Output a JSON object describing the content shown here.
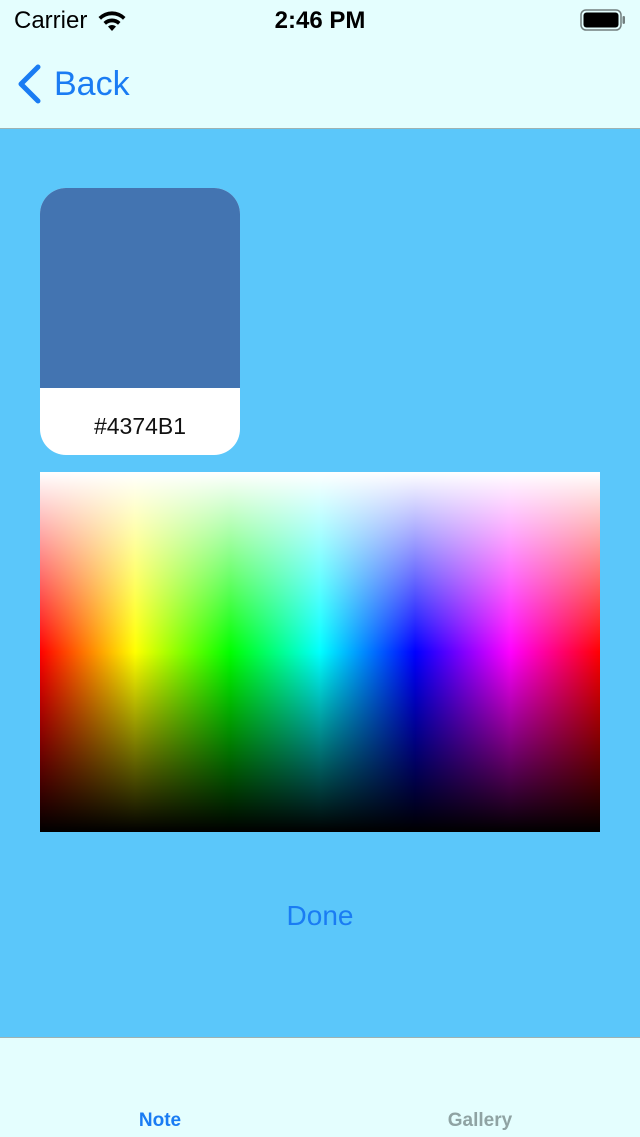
{
  "status_bar": {
    "carrier": "Carrier",
    "time": "2:46 PM"
  },
  "nav": {
    "back_label": "Back"
  },
  "swatch": {
    "hex_label": "#4374B1",
    "color": "#4374B1"
  },
  "done_label": "Done",
  "tabs": [
    {
      "label": "Note",
      "selected": true
    },
    {
      "label": "Gallery",
      "selected": false
    }
  ],
  "colors": {
    "accent": "#1A7CF3",
    "background": "#5BC7FA",
    "bar_background": "#E4FEFE",
    "inactive_tab": "#8FA3A3"
  }
}
